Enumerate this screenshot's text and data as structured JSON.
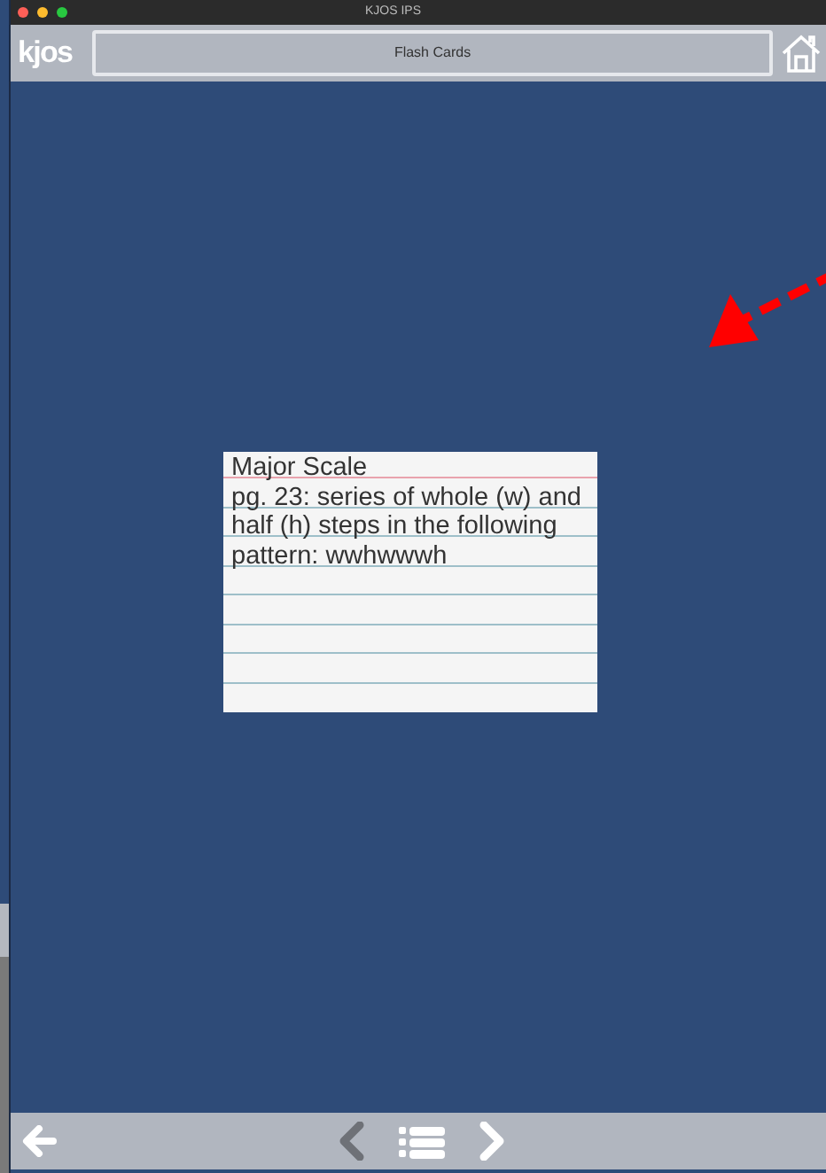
{
  "window": {
    "title": "KJOS IPS"
  },
  "header": {
    "logo": "kjos",
    "title": "Flash Cards"
  },
  "card": {
    "title": "Major Scale",
    "text": "pg. 23: series of whole (w) and half (h) steps in the following pattern: wwhwwwh"
  },
  "footer": {
    "previous_disabled": true,
    "next_disabled": false
  }
}
